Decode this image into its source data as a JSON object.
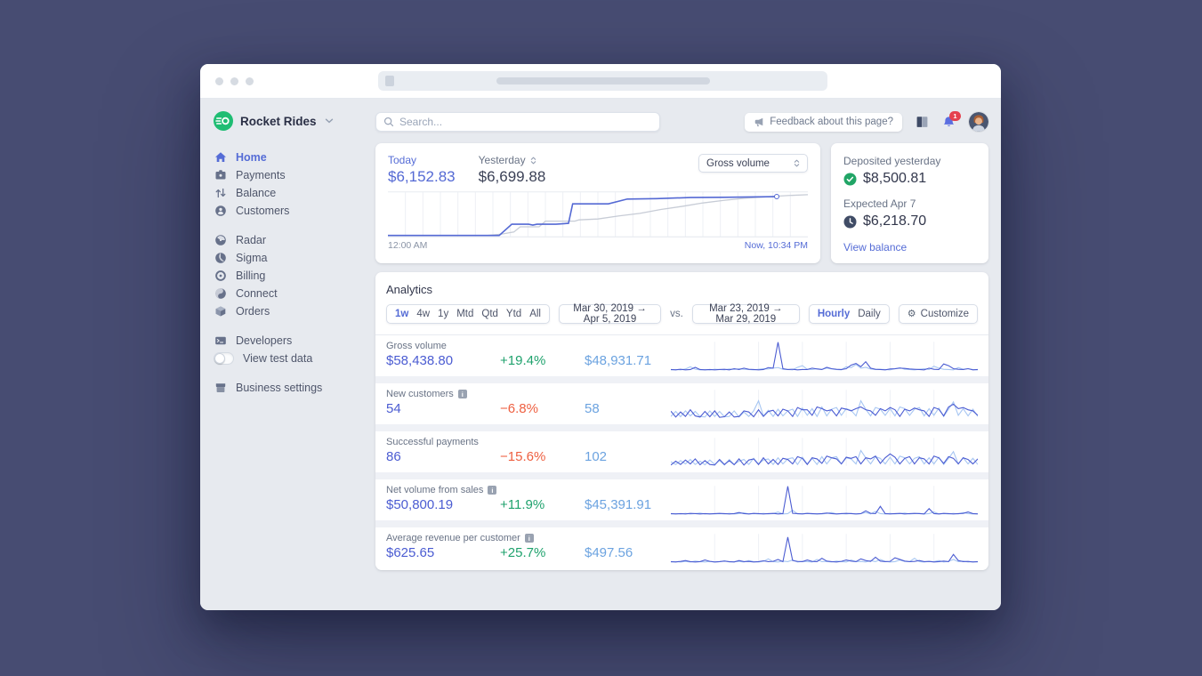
{
  "brand": {
    "name": "Rocket Rides",
    "logo_color": "#1fbd73"
  },
  "search": {
    "placeholder": "Search..."
  },
  "topbar": {
    "feedback_label": "Feedback about this page?",
    "notification_count": "1"
  },
  "sidebar": {
    "sections": [
      {
        "items": [
          {
            "label": "Home",
            "icon": "home",
            "active": true
          },
          {
            "label": "Payments",
            "icon": "payments"
          },
          {
            "label": "Balance",
            "icon": "balance"
          },
          {
            "label": "Customers",
            "icon": "customers"
          }
        ]
      },
      {
        "items": [
          {
            "label": "Radar",
            "icon": "radar"
          },
          {
            "label": "Sigma",
            "icon": "sigma"
          },
          {
            "label": "Billing",
            "icon": "billing"
          },
          {
            "label": "Connect",
            "icon": "connect"
          },
          {
            "label": "Orders",
            "icon": "orders"
          }
        ]
      },
      {
        "items": [
          {
            "label": "Developers",
            "icon": "developers"
          },
          {
            "label": "View test data",
            "icon": "toggle",
            "toggle": true
          }
        ]
      },
      {
        "items": [
          {
            "label": "Business settings",
            "icon": "settings"
          }
        ]
      }
    ]
  },
  "overview": {
    "today_label": "Today",
    "today_value": "$6,152.83",
    "yesterday_label": "Yesterday",
    "yesterday_value": "$6,699.88",
    "select_value": "Gross volume",
    "x_start": "12:00 AM",
    "x_end": "Now, 10:34 PM"
  },
  "deposits": {
    "deposited_label": "Deposited yesterday",
    "deposited_value": "$8,500.81",
    "expected_label": "Expected Apr 7",
    "expected_value": "$6,218.70",
    "view_balance_label": "View balance"
  },
  "analytics": {
    "title": "Analytics",
    "range_options": [
      "1w",
      "4w",
      "1y",
      "Mtd",
      "Qtd",
      "Ytd",
      "All"
    ],
    "range_active": "1w",
    "date_range_primary": "Mar 30, 2019 → Apr 5, 2019",
    "vs_label": "vs.",
    "date_range_comparison": "Mar 23, 2019 → Mar 29, 2019",
    "granularity_options": [
      "Hourly",
      "Daily"
    ],
    "granularity_active": "Hourly",
    "customize_label": "Customize",
    "rows": [
      {
        "label": "Gross volume",
        "info": false,
        "value": "$58,438.80",
        "delta": "+19.4%",
        "delta_dir": "up",
        "comparison": "$48,931.71",
        "spark": {
          "current": [
            2,
            1,
            3,
            1,
            2,
            10,
            2,
            1,
            2,
            1,
            2,
            3,
            1,
            5,
            2,
            7,
            3,
            2,
            1,
            2,
            9,
            7,
            100,
            5,
            2,
            3,
            1,
            2,
            2,
            7,
            4,
            2,
            10,
            5,
            3,
            2,
            5,
            18,
            24,
            12,
            30,
            7,
            3,
            2,
            1,
            4,
            5,
            7,
            6,
            4,
            3,
            2,
            1,
            7,
            3,
            2,
            22,
            16,
            5,
            3,
            2,
            5,
            1,
            2
          ],
          "previous": [
            1,
            2,
            1,
            4,
            12,
            3,
            1,
            2,
            1,
            3,
            2,
            1,
            4,
            2,
            5,
            3,
            2,
            1,
            3,
            5,
            4,
            7,
            9,
            3,
            2,
            1,
            10,
            16,
            3,
            2,
            5,
            3,
            7,
            4,
            2,
            1,
            12,
            9,
            20,
            7,
            10,
            4,
            2,
            3,
            2,
            1,
            5,
            9,
            3,
            2,
            1,
            3,
            5,
            2,
            14,
            7,
            3,
            2,
            1,
            9,
            3,
            5,
            2,
            1
          ]
        }
      },
      {
        "label": "New customers",
        "info": true,
        "value": "54",
        "delta": "−6.8%",
        "delta_dir": "down",
        "comparison": "58",
        "spark": {
          "current": [
            25,
            4,
            22,
            6,
            30,
            8,
            4,
            24,
            5,
            26,
            3,
            5,
            22,
            4,
            6,
            26,
            22,
            5,
            30,
            6,
            24,
            28,
            8,
            32,
            26,
            6,
            38,
            30,
            30,
            10,
            40,
            34,
            26,
            30,
            8,
            36,
            32,
            26,
            34,
            40,
            30,
            26,
            10,
            34,
            26,
            38,
            30,
            6,
            32,
            26,
            36,
            30,
            26,
            6,
            38,
            32,
            8,
            40,
            50,
            34,
            38,
            30,
            26,
            10
          ],
          "previous": [
            6,
            24,
            5,
            26,
            8,
            24,
            6,
            4,
            26,
            6,
            24,
            5,
            6,
            26,
            4,
            22,
            6,
            26,
            62,
            8,
            28,
            6,
            32,
            8,
            26,
            32,
            6,
            36,
            10,
            34,
            6,
            40,
            8,
            32,
            38,
            10,
            34,
            28,
            8,
            62,
            32,
            8,
            38,
            32,
            10,
            34,
            8,
            40,
            34,
            10,
            32,
            38,
            8,
            34,
            10,
            36,
            6,
            32,
            58,
            10,
            34,
            8,
            32,
            6
          ]
        }
      },
      {
        "label": "Successful payments",
        "info": false,
        "value": "86",
        "delta": "−15.6%",
        "delta_dir": "down",
        "comparison": "102",
        "spark": {
          "current": [
            4,
            18,
            6,
            22,
            8,
            26,
            5,
            20,
            6,
            4,
            24,
            6,
            20,
            5,
            26,
            4,
            22,
            26,
            6,
            30,
            8,
            24,
            6,
            28,
            24,
            8,
            34,
            28,
            6,
            30,
            26,
            10,
            36,
            30,
            26,
            8,
            32,
            28,
            34,
            8,
            30,
            26,
            36,
            10,
            30,
            44,
            32,
            8,
            28,
            34,
            8,
            30,
            26,
            8,
            36,
            30,
            10,
            34,
            28,
            8,
            30,
            24,
            8,
            26
          ],
          "previous": [
            16,
            6,
            20,
            8,
            24,
            6,
            18,
            5,
            22,
            6,
            20,
            4,
            24,
            6,
            18,
            24,
            6,
            28,
            8,
            22,
            26,
            6,
            30,
            8,
            26,
            30,
            6,
            32,
            8,
            28,
            6,
            34,
            8,
            30,
            34,
            8,
            30,
            26,
            8,
            56,
            30,
            8,
            34,
            28,
            8,
            32,
            8,
            36,
            30,
            8,
            28,
            34,
            8,
            30,
            8,
            32,
            6,
            28,
            52,
            8,
            30,
            8,
            28,
            6
          ]
        }
      },
      {
        "label": "Net volume from sales",
        "info": true,
        "value": "$50,800.19",
        "delta": "+11.9%",
        "delta_dir": "up",
        "comparison": "$45,391.91",
        "spark": {
          "current": [
            2,
            1,
            2,
            1,
            3,
            2,
            1,
            2,
            1,
            2,
            3,
            2,
            1,
            2,
            6,
            2,
            1,
            3,
            2,
            1,
            2,
            3,
            1,
            2,
            100,
            3,
            2,
            1,
            3,
            2,
            1,
            2,
            4,
            2,
            1,
            2,
            3,
            2,
            1,
            2,
            12,
            3,
            2,
            28,
            2,
            1,
            2,
            3,
            1,
            2,
            3,
            2,
            1,
            20,
            2,
            1,
            3,
            2,
            1,
            2,
            3,
            8,
            2,
            1
          ],
          "previous": [
            1,
            2,
            1,
            3,
            1,
            2,
            4,
            1,
            2,
            1,
            2,
            1,
            3,
            1,
            2,
            5,
            1,
            2,
            1,
            3,
            1,
            2,
            8,
            1,
            2,
            14,
            1,
            2,
            3,
            1,
            2,
            1,
            3,
            6,
            1,
            2,
            1,
            3,
            1,
            2,
            6,
            1,
            10,
            2,
            1,
            3,
            1,
            2,
            4,
            1,
            2,
            3,
            1,
            2,
            8,
            1,
            2,
            1,
            3,
            1,
            6,
            2,
            1,
            2
          ]
        }
      },
      {
        "label": "Average revenue per customer",
        "info": true,
        "value": "$625.65",
        "delta": "+25.7%",
        "delta_dir": "up",
        "comparison": "$497.56",
        "spark": {
          "current": [
            2,
            1,
            3,
            6,
            2,
            1,
            2,
            8,
            3,
            1,
            2,
            4,
            2,
            1,
            6,
            2,
            3,
            1,
            2,
            5,
            2,
            3,
            10,
            2,
            90,
            6,
            3,
            2,
            8,
            3,
            2,
            14,
            4,
            2,
            1,
            3,
            8,
            4,
            2,
            12,
            6,
            3,
            18,
            4,
            2,
            3,
            16,
            10,
            4,
            2,
            3,
            6,
            2,
            3,
            1,
            2,
            4,
            2,
            28,
            6,
            2,
            3,
            1,
            2
          ],
          "previous": [
            1,
            2,
            1,
            3,
            1,
            4,
            2,
            1,
            3,
            1,
            2,
            5,
            1,
            2,
            3,
            1,
            6,
            2,
            1,
            3,
            12,
            2,
            1,
            4,
            2,
            8,
            1,
            3,
            2,
            1,
            10,
            2,
            3,
            1,
            4,
            2,
            1,
            8,
            2,
            3,
            1,
            6,
            2,
            10,
            3,
            1,
            2,
            8,
            3,
            2,
            14,
            2,
            1,
            3,
            2,
            6,
            1,
            3,
            10,
            2,
            4,
            1,
            2,
            1
          ]
        }
      }
    ]
  },
  "chart_data": {
    "type": "line",
    "title": "Gross volume — Today vs Yesterday",
    "x_start_label": "12:00 AM",
    "x_end_label": "Now, 10:34 PM",
    "gridlines": 24,
    "end_marker_series": "Today",
    "series": [
      {
        "name": "Today",
        "color": "#5469d4",
        "points": [
          [
            0,
            0.02
          ],
          [
            0.265,
            0.02
          ],
          [
            0.295,
            0.28
          ],
          [
            0.335,
            0.28
          ],
          [
            0.345,
            0.26
          ],
          [
            0.355,
            0.28
          ],
          [
            0.4,
            0.28
          ],
          [
            0.43,
            0.3
          ],
          [
            0.44,
            0.75
          ],
          [
            0.525,
            0.75
          ],
          [
            0.57,
            0.86
          ],
          [
            0.64,
            0.87
          ],
          [
            0.72,
            0.895
          ],
          [
            0.8,
            0.9
          ],
          [
            0.925,
            0.915
          ]
        ]
      },
      {
        "name": "Yesterday",
        "color": "#c7ccd6",
        "points": [
          [
            0,
            0.02
          ],
          [
            0.235,
            0.02
          ],
          [
            0.27,
            0.05
          ],
          [
            0.3,
            0.1
          ],
          [
            0.315,
            0.22
          ],
          [
            0.36,
            0.22
          ],
          [
            0.375,
            0.35
          ],
          [
            0.445,
            0.35
          ],
          [
            0.455,
            0.38
          ],
          [
            0.5,
            0.4
          ],
          [
            0.55,
            0.47
          ],
          [
            0.6,
            0.53
          ],
          [
            0.65,
            0.62
          ],
          [
            0.7,
            0.69
          ],
          [
            0.75,
            0.77
          ],
          [
            0.8,
            0.83
          ],
          [
            0.85,
            0.88
          ],
          [
            0.9,
            0.91
          ],
          [
            0.95,
            0.94
          ],
          [
            1,
            0.96
          ]
        ]
      }
    ]
  }
}
